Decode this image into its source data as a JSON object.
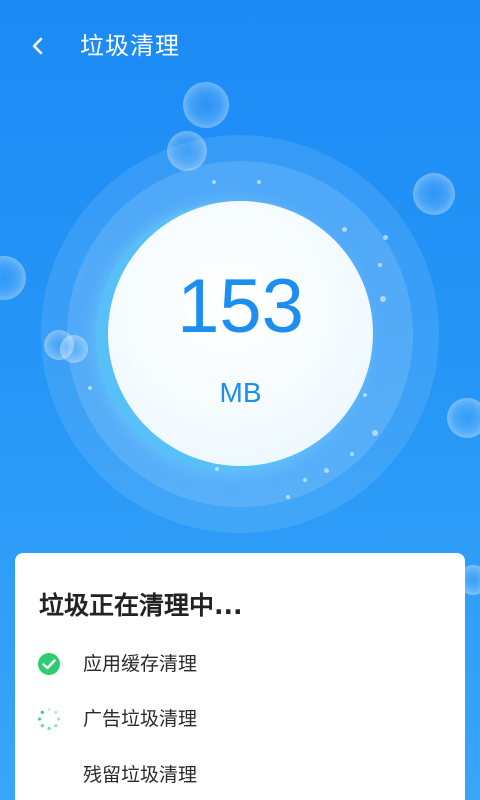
{
  "header": {
    "back_icon": "chevron-left-icon",
    "title": "垃圾清理"
  },
  "scan": {
    "size_value": "153",
    "size_unit": "MB"
  },
  "card": {
    "title": "垃圾正在清理中...",
    "tasks": [
      {
        "label": "应用缓存清理",
        "status": "done",
        "icon": "check-circle-icon"
      },
      {
        "label": "广告垃圾清理",
        "status": "in-progress",
        "icon": "spinner-icon"
      },
      {
        "label": "残留垃圾清理",
        "status": "pending",
        "icon": ""
      }
    ]
  },
  "colors": {
    "background_top": "#1c8af5",
    "accent": "#1c8ef2",
    "success": "#2ecc71"
  }
}
